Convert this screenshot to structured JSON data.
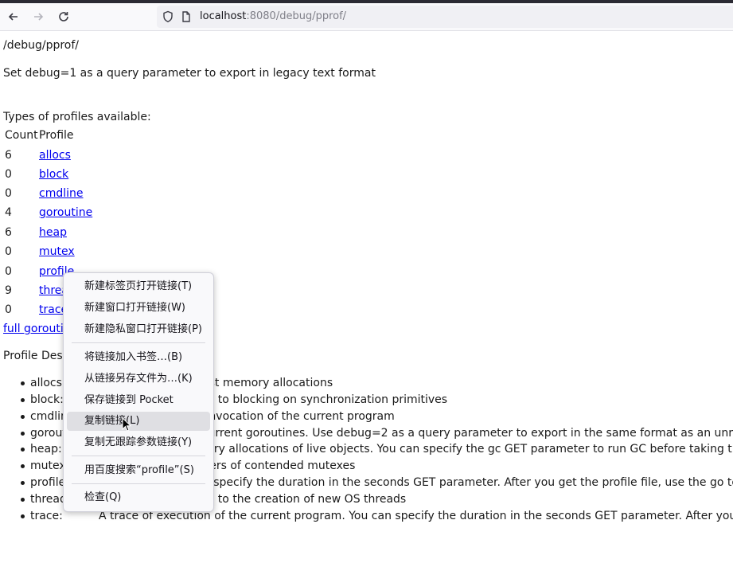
{
  "browser": {
    "back_icon": "arrow-left-icon",
    "forward_icon": "arrow-right-icon",
    "reload_icon": "reload-icon",
    "url_host": "localhost",
    "url_rest": ":8080/debug/pprof/"
  },
  "page": {
    "path": "/debug/pprof/",
    "hint": "Set debug=1 as a query parameter to export in legacy text format",
    "types_heading": "Types of profiles available:",
    "table_headers": {
      "count": "Count",
      "profile": "Profile"
    },
    "profiles": [
      {
        "count": "6",
        "name": "allocs"
      },
      {
        "count": "0",
        "name": "block"
      },
      {
        "count": "0",
        "name": "cmdline"
      },
      {
        "count": "4",
        "name": "goroutine"
      },
      {
        "count": "6",
        "name": "heap"
      },
      {
        "count": "0",
        "name": "mutex"
      },
      {
        "count": "0",
        "name": "profile"
      },
      {
        "count": "9",
        "name": "threadcreate"
      },
      {
        "count": "0",
        "name": "trace"
      }
    ],
    "full_goroutine_link": "full goroutine stack dump",
    "desc_heading": "Profile Descriptions:",
    "descriptions": [
      {
        "name": "allocs:",
        "text": "A sampling of all past memory allocations"
      },
      {
        "name": "block:",
        "text": "Stack traces that led to blocking on synchronization primitives"
      },
      {
        "name": "cmdline:",
        "text": "The command line invocation of the current program"
      },
      {
        "name": "goroutine:",
        "text": "Stack traces of all current goroutines. Use debug=2 as a query parameter to export in the same format as an unrecovered panic."
      },
      {
        "name": "heap:",
        "text": "A sampling of memory allocations of live objects. You can specify the gc GET parameter to run GC before taking the heap sample."
      },
      {
        "name": "mutex:",
        "text": "Stack traces of holders of contended mutexes"
      },
      {
        "name": "profile:",
        "text": "CPU profile. You can specify the duration in the seconds GET parameter. After you get the profile file, use the go tool pprof command to investigate the profile."
      },
      {
        "name": "threadcreate:",
        "text": "Stack traces that led to the creation of new OS threads"
      },
      {
        "name": "trace:",
        "text": "A trace of execution of the current program. You can specify the duration in the seconds GET parameter. After you get the trace file, use the go tool trace command to investigate the trace."
      }
    ]
  },
  "context_menu": {
    "items": [
      "新建标签页打开链接(T)",
      "新建窗口打开链接(W)",
      "新建隐私窗口打开链接(P)",
      "将链接加入书签…(B)",
      "从链接另存文件为…(K)",
      "保存链接到 Pocket",
      "复制链接(L)",
      "复制无跟踪参数链接(Y)",
      "用百度搜索“profile”(S)",
      "检查(Q)"
    ],
    "hovered_item": "复制链接(L)"
  }
}
